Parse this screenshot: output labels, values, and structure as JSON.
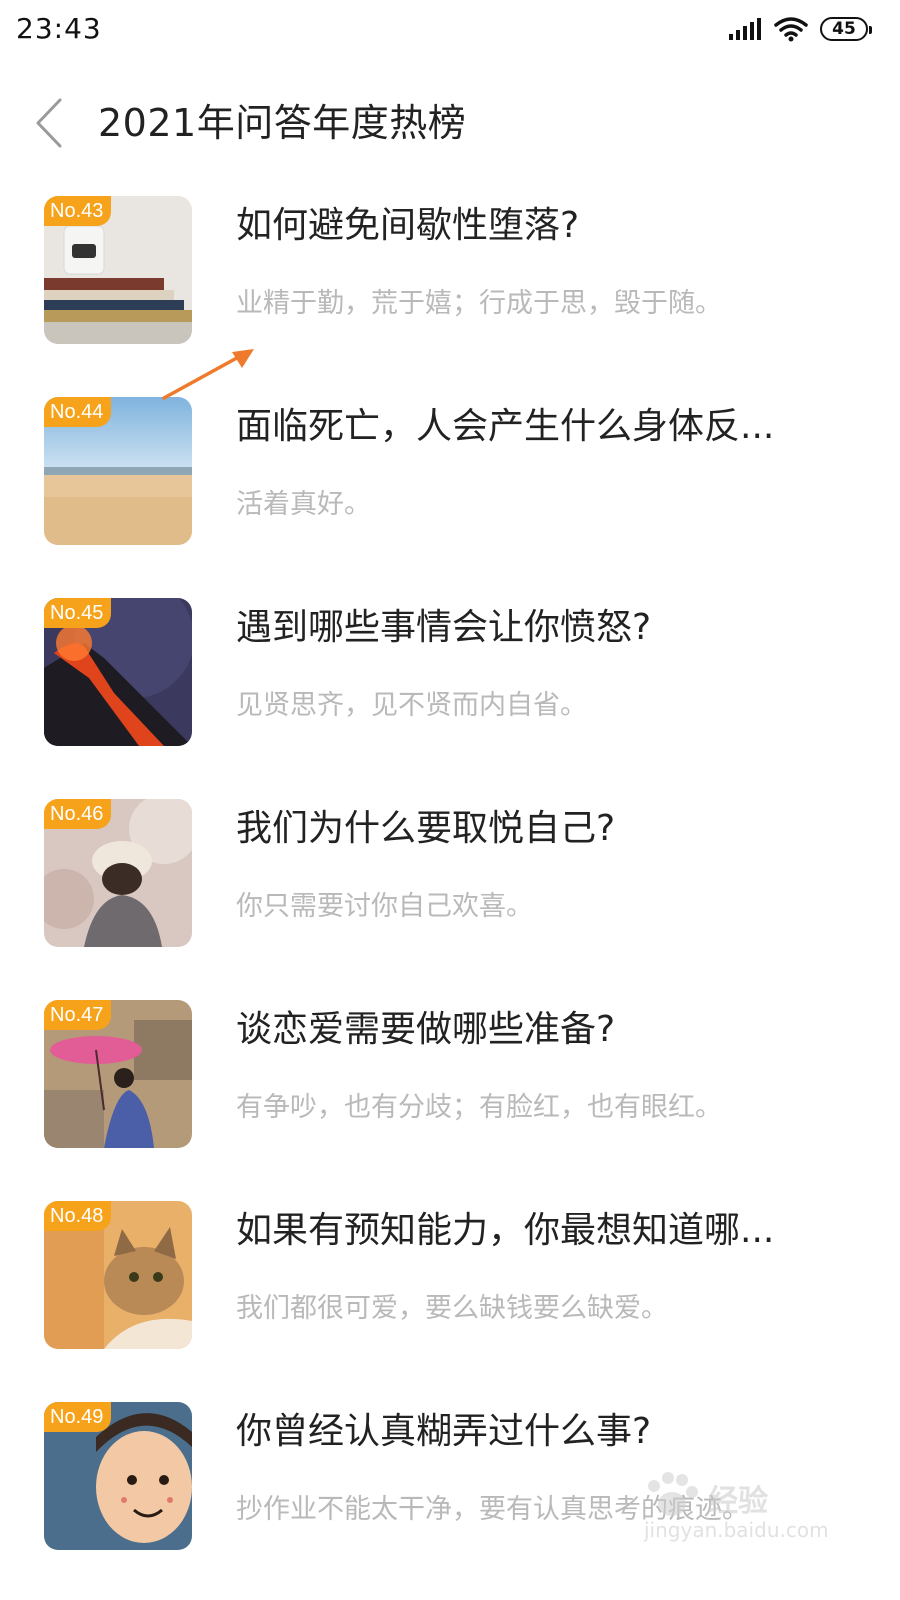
{
  "status_bar": {
    "time": "23:43",
    "battery": "45",
    "icons": [
      "signal-icon",
      "wifi-icon",
      "battery-icon"
    ]
  },
  "header": {
    "back_icon": "chevron-left-icon",
    "title": "2021年问答年度热榜"
  },
  "colors": {
    "badge": "#f7a21b",
    "title_text": "#222222",
    "subtitle_text": "#b9b9b9",
    "annotation_arrow": "#f07a2b"
  },
  "items": [
    {
      "rank": "No.43",
      "title": "如何避免间歇性堕落?",
      "subtitle": "业精于勤，荒于嬉；行成于思，毁于随。",
      "thumb": "books-and-jar"
    },
    {
      "rank": "No.44",
      "title": "面临死亡，人会产生什么身体反...",
      "subtitle": "活着真好。",
      "thumb": "beach"
    },
    {
      "rank": "No.45",
      "title": "遇到哪些事情会让你愤怒?",
      "subtitle": "见贤思齐，见不贤而内自省。",
      "thumb": "volcano"
    },
    {
      "rank": "No.46",
      "title": "我们为什么要取悦自己?",
      "subtitle": "你只需要讨你自己欢喜。",
      "thumb": "girl-with-hat"
    },
    {
      "rank": "No.47",
      "title": "谈恋爱需要做哪些准备?",
      "subtitle": "有争吵，也有分歧；有脸红，也有眼红。",
      "thumb": "girl-with-umbrella"
    },
    {
      "rank": "No.48",
      "title": "如果有预知能力，你最想知道哪...",
      "subtitle": "我们都很可爱，要么缺钱要么缺爱。",
      "thumb": "cat"
    },
    {
      "rank": "No.49",
      "title": "你曾经认真糊弄过什么事?",
      "subtitle": "抄作业不能太干净，要有认真思考的痕迹。",
      "thumb": "cartoon-face"
    }
  ],
  "watermark": {
    "text": "经验",
    "url": "jingyan.baidu.com"
  }
}
